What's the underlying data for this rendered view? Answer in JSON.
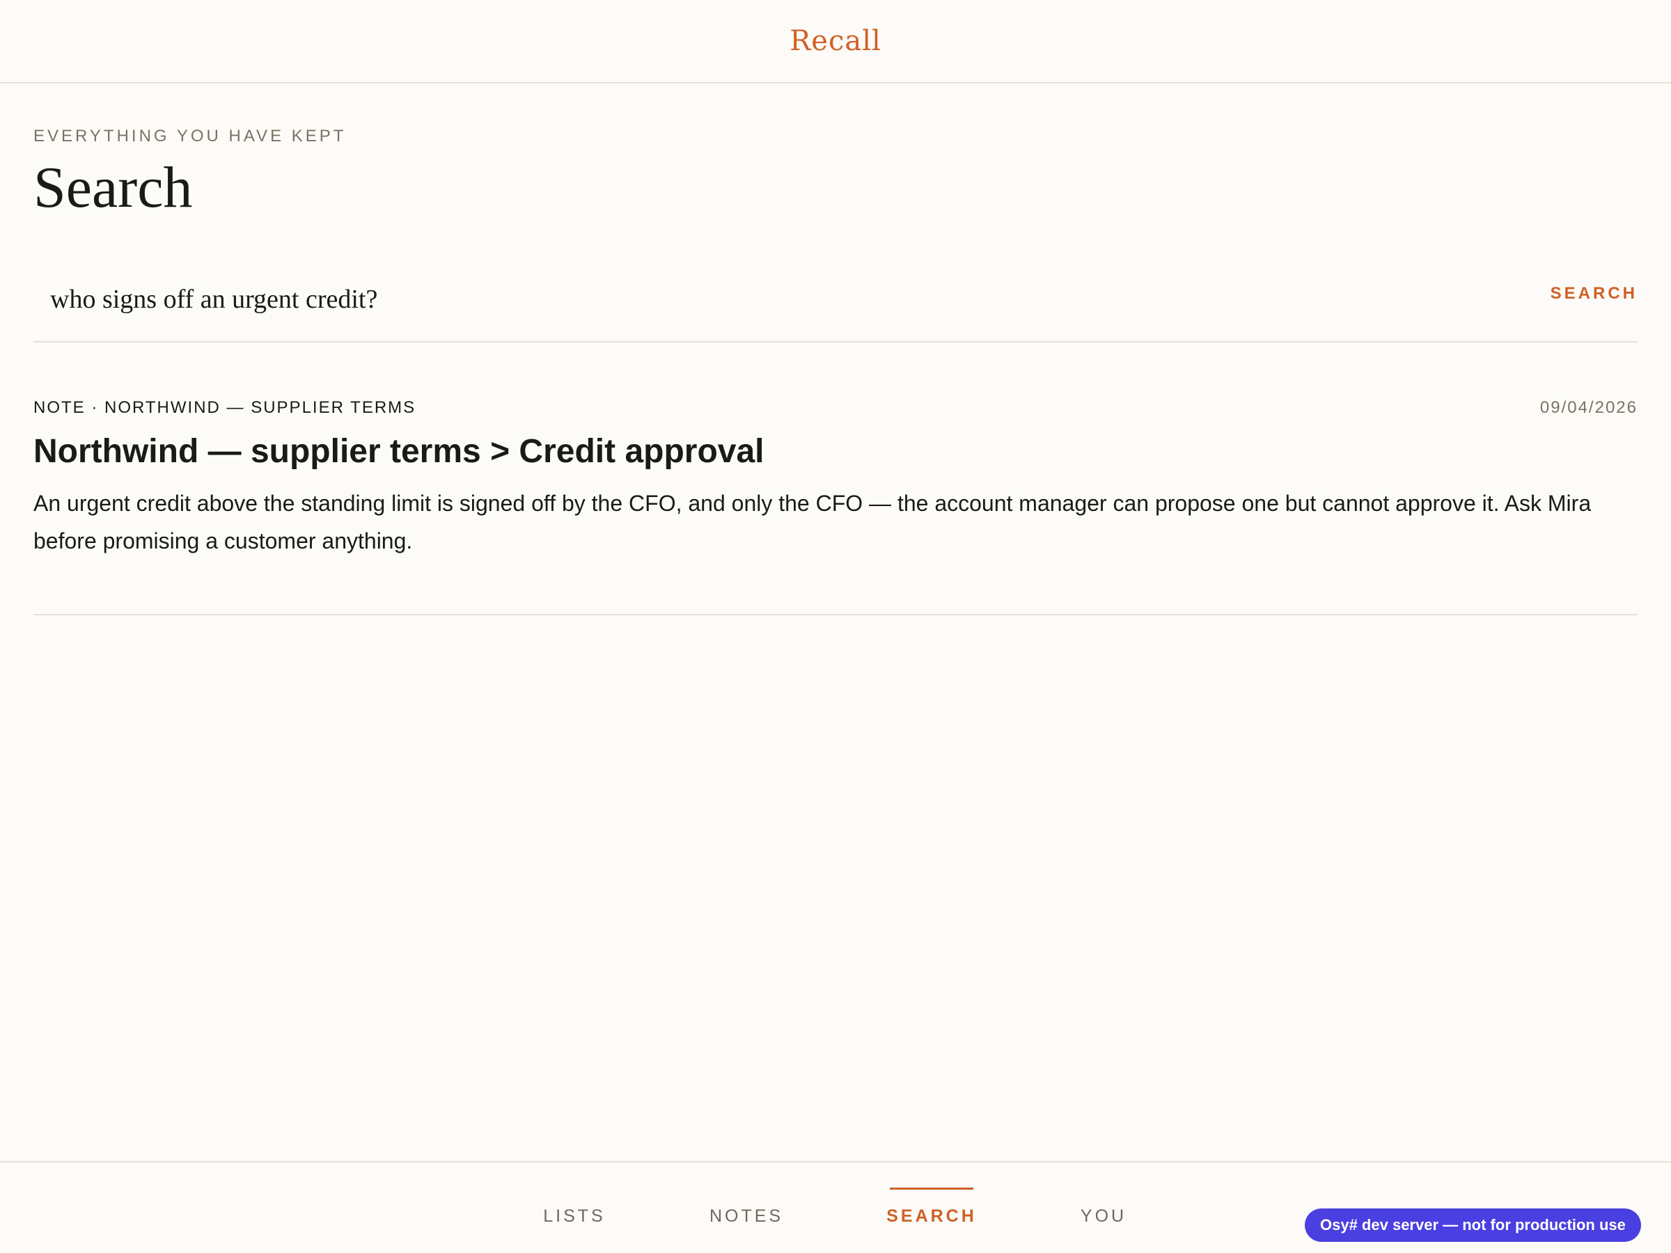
{
  "header": {
    "app_title": "Recall"
  },
  "main": {
    "eyebrow": "EVERYTHING YOU HAVE KEPT",
    "title": "Search"
  },
  "search": {
    "query": "who signs off an urgent credit?",
    "button_label": "SEARCH"
  },
  "results": [
    {
      "meta": "NOTE · NORTHWIND — SUPPLIER TERMS",
      "date": "09/04/2026",
      "title": "Northwind — supplier terms > Credit approval",
      "body": "An urgent credit above the standing limit is signed off by the CFO, and only the CFO — the account manager can propose one but cannot approve it. Ask Mira before promising a customer anything."
    }
  ],
  "nav": {
    "items": [
      {
        "label": "LISTS",
        "active": false
      },
      {
        "label": "NOTES",
        "active": false
      },
      {
        "label": "SEARCH",
        "active": true
      },
      {
        "label": "YOU",
        "active": false
      }
    ]
  },
  "dev_badge": "Osy# dev server — not for production use",
  "colors": {
    "accent": "#cf6125",
    "background": "#fcfbf7",
    "text": "#1b1a17",
    "muted": "#7b7265",
    "divider": "#e6e1d6",
    "badge": "#4a3fe0"
  }
}
